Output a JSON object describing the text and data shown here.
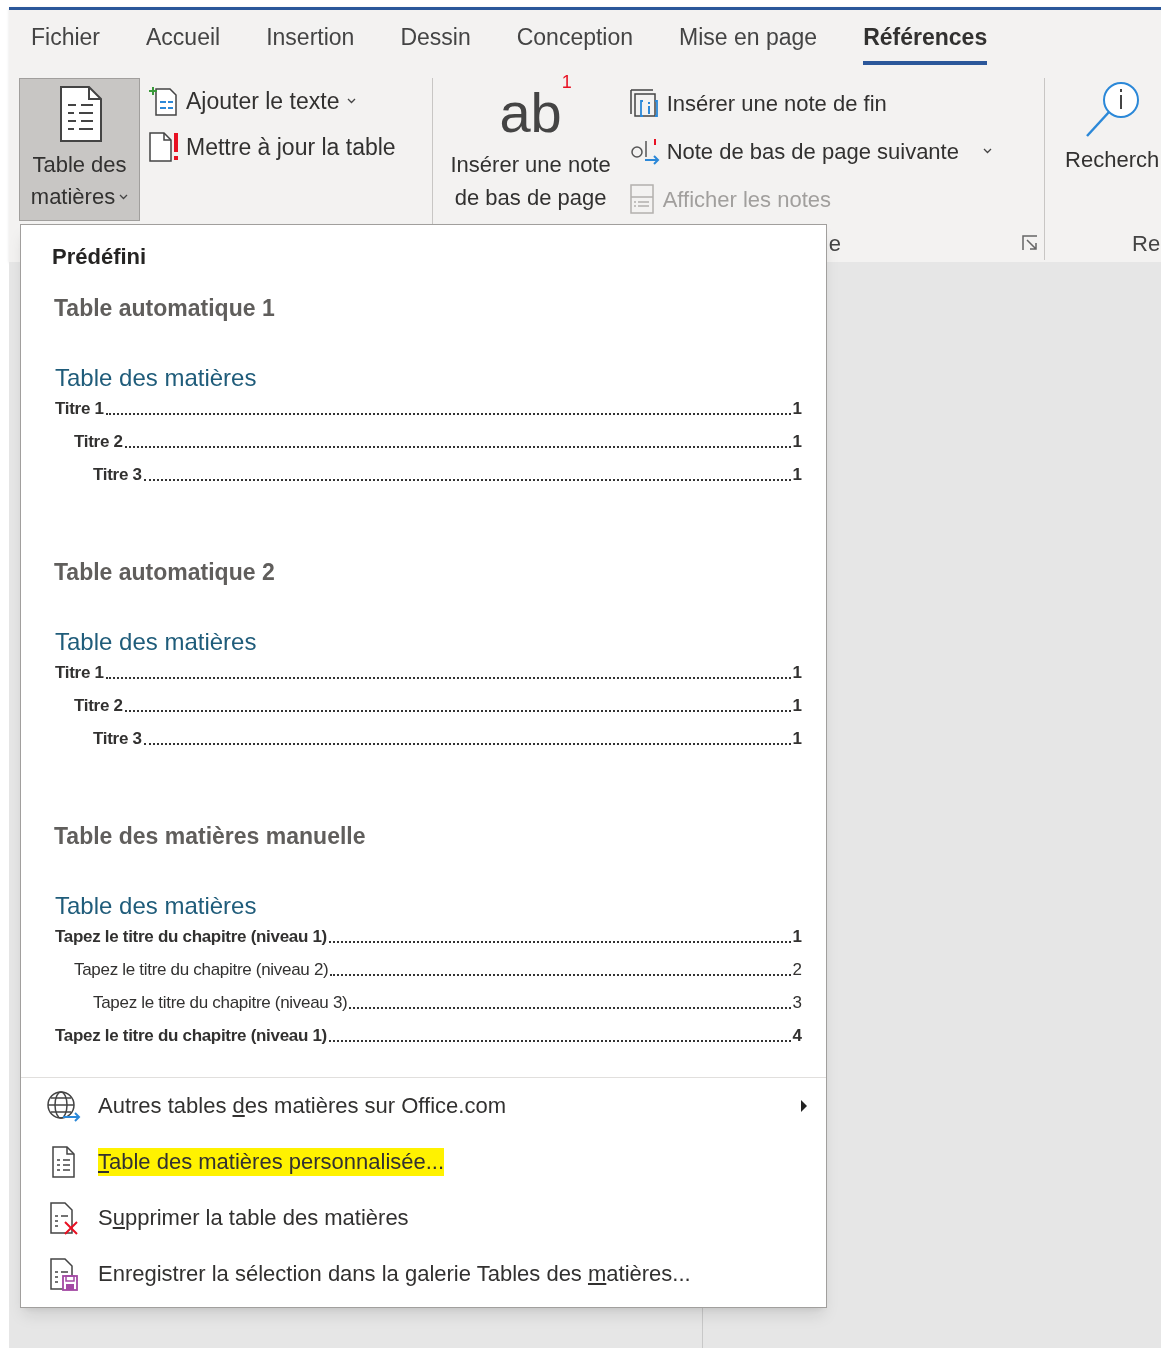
{
  "ribbon": {
    "tabs": [
      {
        "label": "Fichier",
        "selected": false
      },
      {
        "label": "Accueil",
        "selected": false
      },
      {
        "label": "Insertion",
        "selected": false
      },
      {
        "label": "Dessin",
        "selected": false
      },
      {
        "label": "Conception",
        "selected": false
      },
      {
        "label": "Mise en page",
        "selected": false
      },
      {
        "label": "Références",
        "selected": true
      }
    ],
    "toc_group": {
      "toc_button": {
        "label": "Table des matières",
        "has_dropdown": true,
        "pressed": true
      },
      "add_text_button": {
        "label": "Ajouter le texte",
        "has_dropdown": true
      },
      "update_table_button": {
        "label": "Mettre à jour la table"
      }
    },
    "footnotes_group": {
      "insert_footnote_button": {
        "icon_text": "ab",
        "icon_superscript": "1",
        "label": "Insérer une note de bas de page"
      },
      "insert_endnote_button": {
        "label": "Insérer une note de fin"
      },
      "next_footnote_button": {
        "label": "Note de bas de page suivante",
        "has_dropdown": true
      },
      "show_notes_button": {
        "label": "Afficher les notes",
        "disabled": true
      },
      "group_label": "e",
      "has_dialog_launcher": true
    },
    "research_group": {
      "research_button": {
        "label": "Recherch"
      },
      "group_label": "Re"
    }
  },
  "toc_menu": {
    "heading": "Prédéfini",
    "gallery": [
      {
        "kind": "automatic",
        "name": "Table automatique 1",
        "preview": {
          "title": "Table des matières",
          "entries": [
            {
              "text": "Titre 1",
              "page": "1",
              "children": [
                {
                  "text": "Titre 2",
                  "page": "1",
                  "children": [
                    {
                      "text": "Titre 3",
                      "page": "1"
                    }
                  ]
                }
              ]
            }
          ]
        }
      },
      {
        "kind": "automatic",
        "name": "Table automatique 2",
        "preview": {
          "title": "Table des matières",
          "entries": [
            {
              "text": "Titre 1",
              "page": "1",
              "children": [
                {
                  "text": "Titre 2",
                  "page": "1",
                  "children": [
                    {
                      "text": "Titre 3",
                      "page": "1"
                    }
                  ]
                }
              ]
            }
          ]
        }
      },
      {
        "kind": "manual",
        "name": "Table des matières manuelle",
        "preview": {
          "title": "Table des matières",
          "entries": [
            {
              "text": "Tapez le titre du chapitre (niveau 1)",
              "page": "1",
              "children": [
                {
                  "text": "Tapez le titre du chapitre (niveau 2)",
                  "page": "2",
                  "children": [
                    {
                      "text": "Tapez le titre du chapitre (niveau 3)",
                      "page": "3"
                    }
                  ]
                }
              ]
            },
            {
              "text": "Tapez le titre du chapitre (niveau 1)",
              "page": "4"
            }
          ]
        }
      }
    ],
    "commands": [
      {
        "kind": "online",
        "text_before": "Autres tables ",
        "access_key": "d",
        "text_after": "es matières sur Office.com",
        "has_submenu": true,
        "highlighted": false
      },
      {
        "kind": "custom",
        "access_key": "T",
        "text_after": "able des matières personnalisée...",
        "has_submenu": false,
        "highlighted": true
      },
      {
        "kind": "remove",
        "text_before": "S",
        "access_key": "u",
        "text_after": "pprimer la table des matières",
        "has_submenu": false,
        "highlighted": false
      },
      {
        "kind": "save",
        "text_before": "Enregistrer la sélection dans la galerie Tables des ",
        "access_key": "m",
        "text_after": "atières...",
        "has_submenu": false,
        "highlighted": false
      }
    ]
  }
}
